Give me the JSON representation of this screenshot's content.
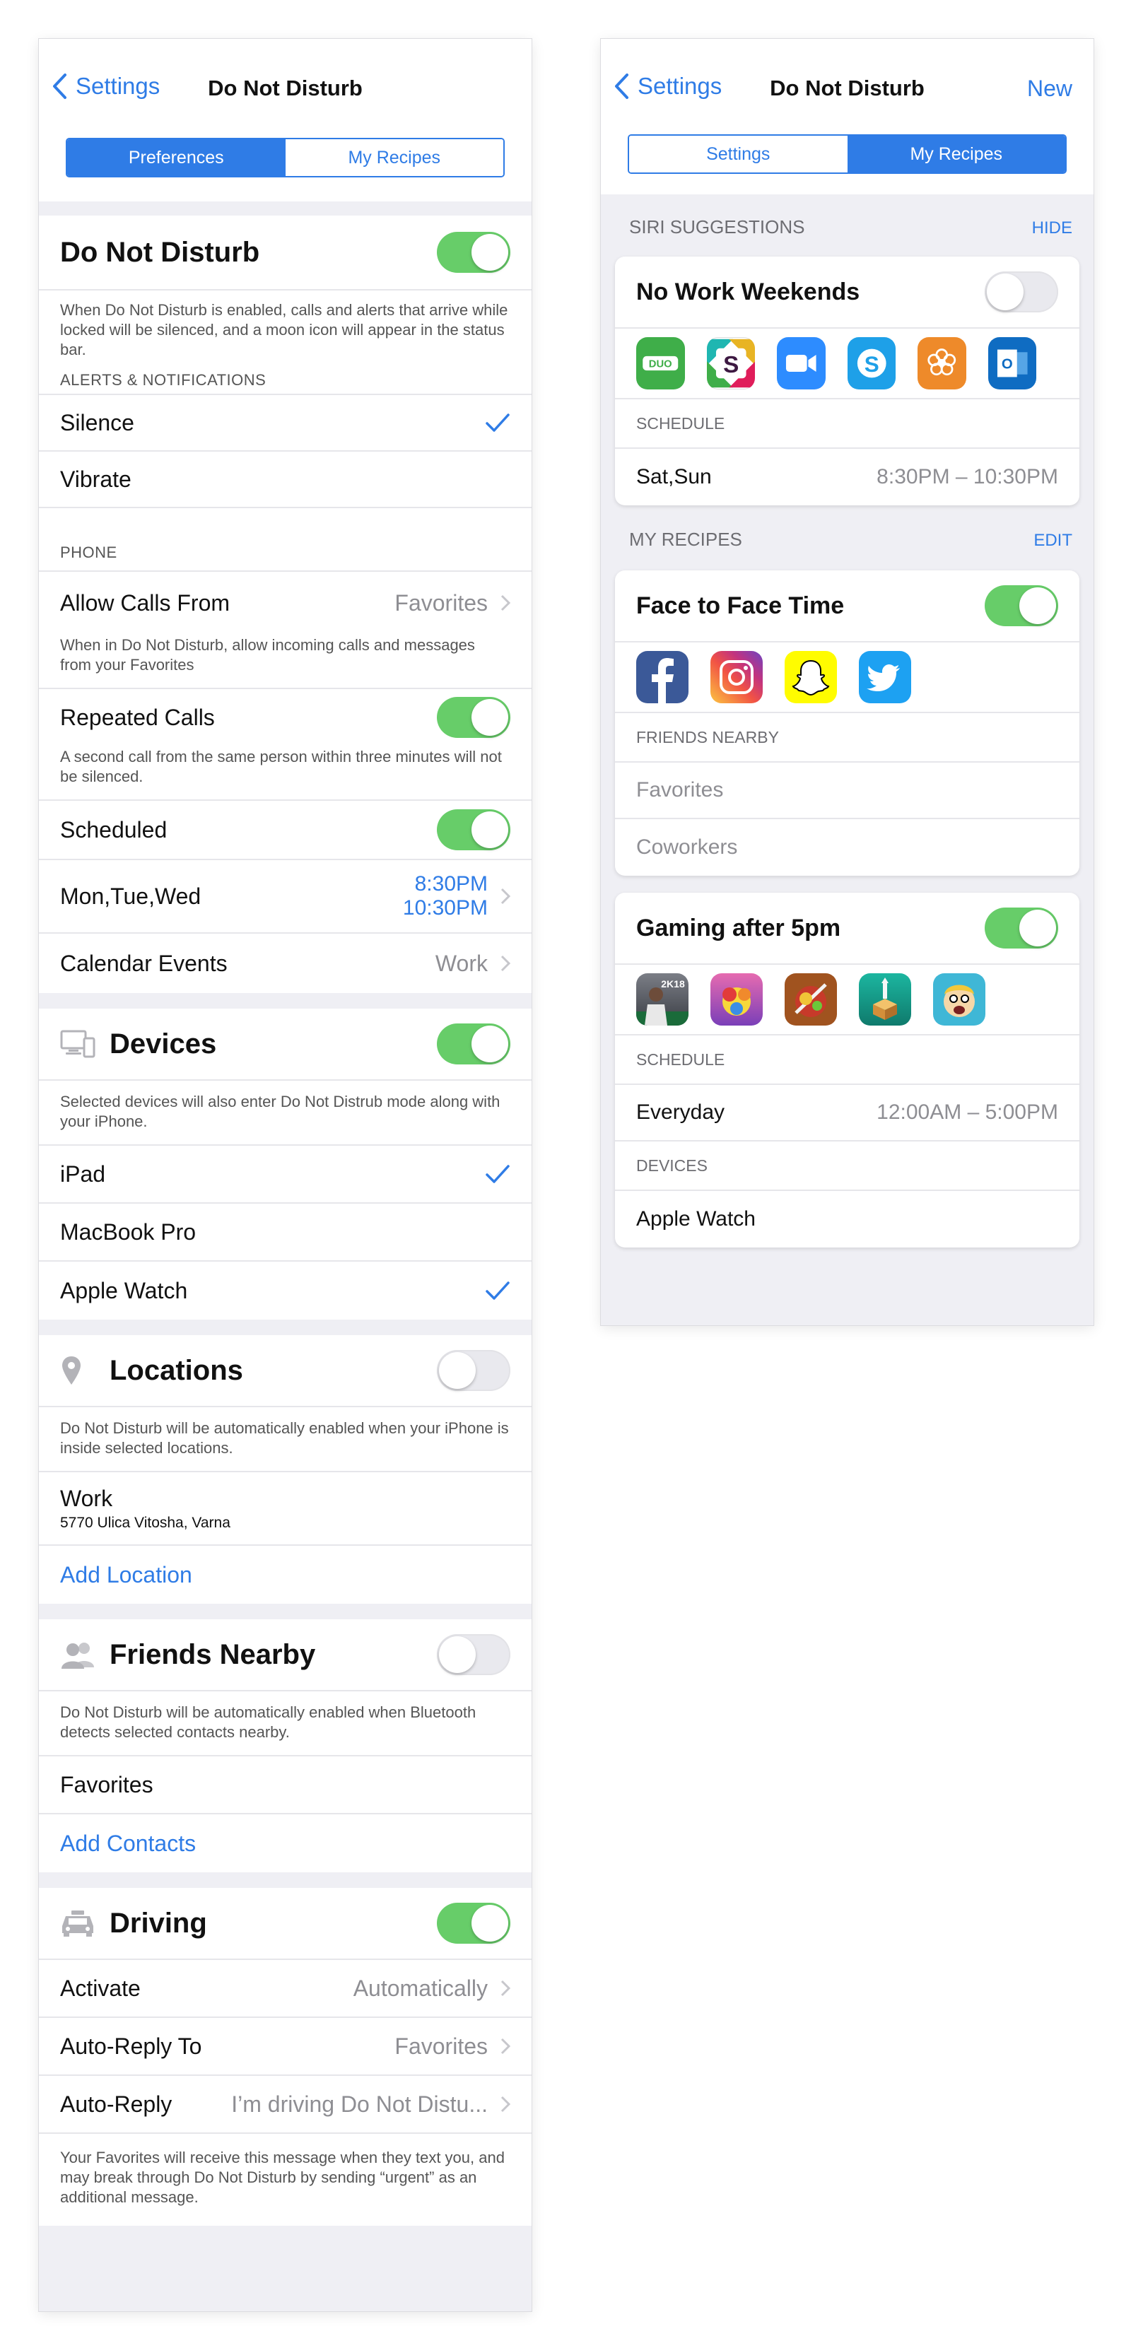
{
  "left": {
    "nav": {
      "back": "Settings",
      "title": "Do Not Disturb"
    },
    "segment": {
      "a": "Preferences",
      "b": "My Recipes"
    },
    "dnd": {
      "title": "Do Not Disturb",
      "enabled": true,
      "desc": "When Do Not Disturb is enabled, calls and alerts that arrive while locked will be silenced, and a moon icon will appear in the status bar.",
      "alerts_header": "ALERTS & NOTIFICATIONS",
      "silence": "Silence",
      "vibrate": "Vibrate",
      "phone_header": "PHONE",
      "allow_calls_label": "Allow Calls From",
      "allow_calls_value": "Favorites",
      "allow_desc": "When in Do Not Disturb, allow incoming calls and messages from your Favorites",
      "repeated_label": "Repeated Calls",
      "repeated_desc": "A second call from the same person within three minutes will not be silenced."
    },
    "scheduled": {
      "label": "Scheduled",
      "days": "Mon,Tue,Wed",
      "time_start": "8:30PM",
      "time_end": "10:30PM",
      "calendar_label": "Calendar Events",
      "calendar_value": "Work"
    },
    "devices": {
      "title": "Devices",
      "desc": "Selected devices will also enter Do Not Distrub mode along with your iPhone.",
      "items": [
        "iPad",
        "MacBook Pro",
        "Apple Watch"
      ]
    },
    "locations": {
      "title": "Locations",
      "desc": "Do Not Disturb will be automatically enabled when your iPhone is inside selected locations.",
      "work_label": "Work",
      "work_address": "5770 Ulica Vitosha, Varna",
      "add": "Add Location"
    },
    "friends": {
      "title": "Friends Nearby",
      "desc": "Do Not Disturb will be automatically enabled when Bluetooth detects selected contacts nearby.",
      "favorites": "Favorites",
      "add": "Add Contacts"
    },
    "driving": {
      "title": "Driving",
      "activate_label": "Activate",
      "activate_value": "Automatically",
      "autoreply_to_label": "Auto-Reply To",
      "autoreply_to_value": "Favorites",
      "autoreply_label": "Auto-Reply",
      "autoreply_value": "I’m driving Do Not Distu...",
      "desc": "Your Favorites will receive this message when they text you, and may break through Do Not Disturb by sending “urgent” as an additional message."
    }
  },
  "right": {
    "nav": {
      "back": "Settings",
      "title": "Do Not Disturb",
      "new": "New"
    },
    "segment": {
      "a": "Settings",
      "b": "My Recipes"
    },
    "siri": {
      "header": "SIRI SUGGESTIONS",
      "action": "HIDE"
    },
    "nowork": {
      "title": "No Work Weekends",
      "apps": [
        "duo-app-icon",
        "slack-app-icon",
        "zoom-app-icon",
        "skype-app-icon",
        "flower-app-icon",
        "outlook-app-icon"
      ],
      "schedule_label": "SCHEDULE",
      "days": "Sat,Sun",
      "time": "8:30PM – 10:30PM"
    },
    "recipes": {
      "header": "MY RECIPES",
      "action": "EDIT"
    },
    "face": {
      "title": "Face to Face Time",
      "apps": [
        "facebook-app-icon",
        "instagram-app-icon",
        "snapchat-app-icon",
        "twitter-app-icon"
      ],
      "sub": "FRIENDS NEARBY",
      "items": [
        "Favorites",
        "Coworkers"
      ]
    },
    "gaming": {
      "title": "Gaming after 5pm",
      "apps": [
        "nba2k18-app-icon",
        "candy-crush-app-icon",
        "fruit-ninja-app-icon",
        "monument-valley-app-icon",
        "fallout-shelter-app-icon"
      ],
      "nba_text": "2K18",
      "schedule_label": "SCHEDULE",
      "days": "Everyday",
      "time": "12:00AM – 5:00PM",
      "devices_label": "DEVICES",
      "device": "Apple Watch"
    }
  },
  "colors": {
    "accent": "#2f7ce6",
    "toggle_on": "#67cd69",
    "group_bg": "#efeff4"
  }
}
